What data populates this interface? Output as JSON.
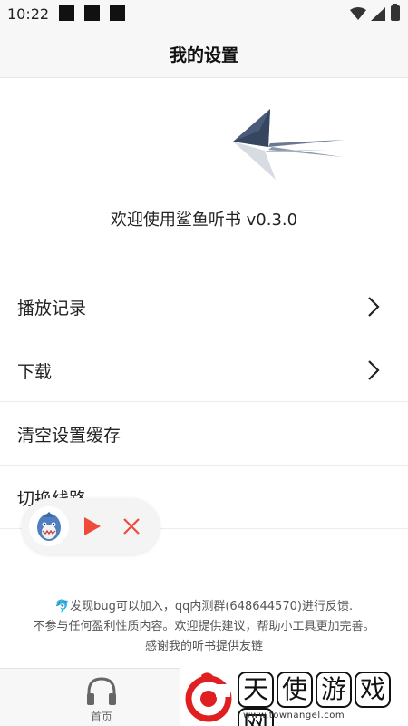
{
  "status_bar": {
    "time": "10:22",
    "icons": [
      "notification-square",
      "notification-square",
      "notification-square",
      "wifi-icon",
      "signal-icon",
      "battery-icon"
    ]
  },
  "header": {
    "title": "我的设置"
  },
  "app": {
    "welcome": "欢迎使用鲨鱼听书 v0.3.0",
    "logo_icon": "shark-fin-logo",
    "accent_color": "#4a5a7a"
  },
  "menu": {
    "items": [
      {
        "label": "播放记录",
        "icon": "chevron-right-icon"
      },
      {
        "label": "下载",
        "icon": "chevron-right-icon"
      },
      {
        "label": "清空设置缓存"
      },
      {
        "label": "切换线路"
      }
    ]
  },
  "player": {
    "avatar_icon": "shark-avatar",
    "play_icon": "play-icon",
    "close_icon": "close-icon",
    "play_color": "#f04a3a"
  },
  "footer": {
    "line1": "🐬发现bug可以加入，qq内测群(648644570)进行反馈.",
    "line2": "不参与任何盈利性质内容。欢迎提供建议，帮助小工具更加完善。",
    "line3": "感谢我的听书提供友链"
  },
  "tabbar": {
    "home_label": "首页",
    "home_icon": "headphones-icon"
  },
  "watermark": {
    "chars": [
      "天",
      "使",
      "游",
      "戏",
      "网"
    ],
    "url": "www.townangel.com",
    "logo_color": "#e02020"
  }
}
